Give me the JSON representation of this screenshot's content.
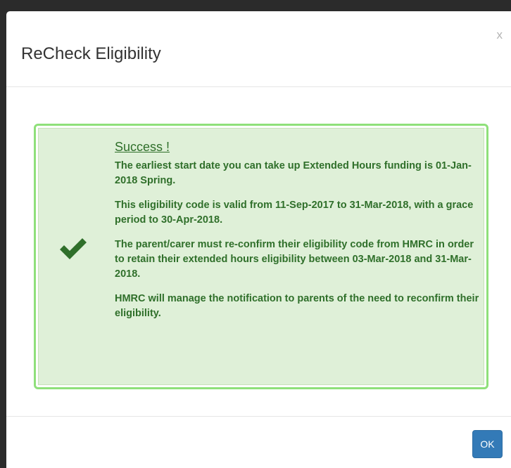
{
  "dialog": {
    "title": "ReCheck Eligibility",
    "close_label": "x"
  },
  "alert": {
    "status": "success",
    "icon": "checkmark-icon",
    "accent_color": "#2f6f2a",
    "background_color": "#dff0d8",
    "heading": "Success !",
    "paragraphs": [
      "The earliest start date you can take up Extended Hours funding is 01-Jan-2018 Spring.",
      "This eligibility code is valid from 11-Sep-2017 to 31-Mar-2018, with a grace period to 30-Apr-2018.",
      "The parent/carer must re-confirm their eligibility code from HMRC in order to retain their extended hours eligibility between 03-Mar-2018 and 31-Mar-2018.",
      "HMRC will manage the notification to parents of the need to reconfirm their eligibility."
    ]
  },
  "footer": {
    "ok_label": "OK",
    "ok_color": "#337ab7"
  }
}
